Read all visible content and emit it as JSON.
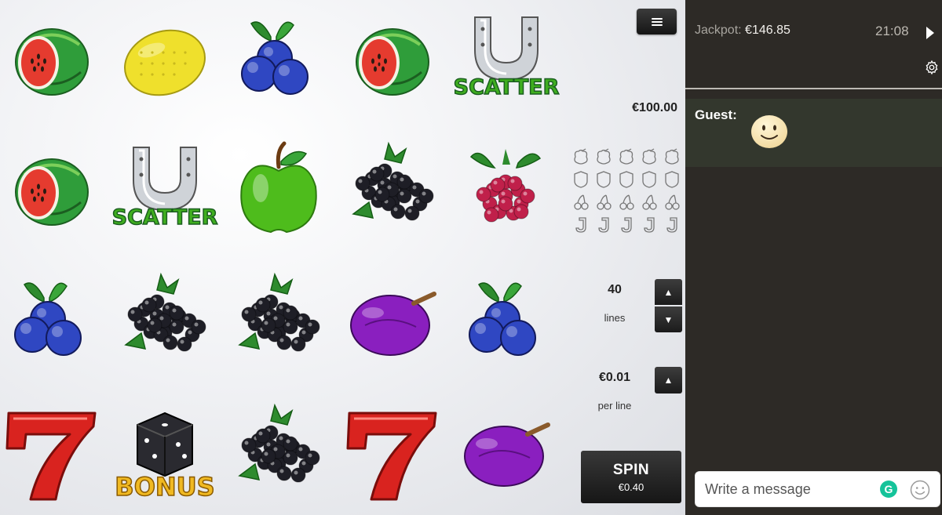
{
  "game": {
    "reels": [
      [
        "watermelon",
        "watermelon",
        "blueberries",
        "seven"
      ],
      [
        "lemon",
        "scatter",
        "blackberries",
        "bonus"
      ],
      [
        "blueberries",
        "apple",
        "blackberries",
        "blackberries"
      ],
      [
        "watermelon",
        "blackberries",
        "plum",
        "seven"
      ],
      [
        "scatter",
        "raspberry",
        "blueberries",
        "plum"
      ]
    ],
    "scatter_text": "SCATTER",
    "bonus_text": "BONUS",
    "balance": "€100.00",
    "paytable_rows": [
      "raspberry-outline-icon",
      "shield-outline-icon",
      "cherries-outline-icon",
      "j-outline-icon"
    ],
    "lines_value": "40",
    "lines_label": "lines",
    "bet_value": "€0.01",
    "bet_label": "per line",
    "spin_label": "SPIN",
    "spin_amount": "€0.40",
    "colors": {
      "watermelon_red": "#e53b2f",
      "watermelon_green": "#2f9d3a",
      "lemon": "#efe02c",
      "blueberry": "#2f47c2",
      "apple": "#4ebc1c",
      "blackberry": "#1e1e26",
      "raspberry": "#c0204a",
      "plum": "#8a1fbf",
      "seven": "#d9231f",
      "scatter_text": "#3fae1f",
      "bonus_text": "#f0b922"
    }
  },
  "side": {
    "jackpot_label": "Jackpot:",
    "jackpot_value": "€146.85",
    "time": "21:08",
    "chat_user": "Guest:",
    "message_placeholder": "Write a message",
    "grammarly_letter": "G"
  }
}
